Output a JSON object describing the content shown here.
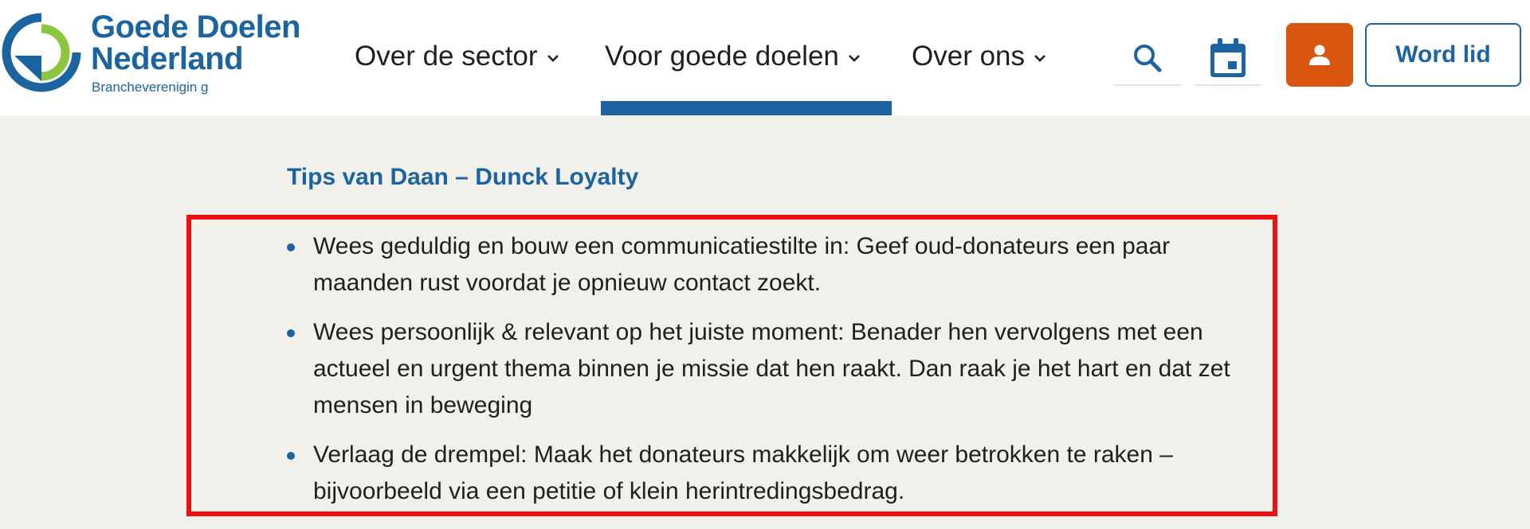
{
  "logo": {
    "line1": "Goede Doelen",
    "line2": "Nederland",
    "subtitle": "Brancheverenigin g"
  },
  "nav": {
    "items": [
      {
        "label": "Over de sector"
      },
      {
        "label": "Voor goede doelen"
      },
      {
        "label": "Over ons"
      }
    ]
  },
  "header_actions": {
    "search_icon": "search-icon",
    "calendar_icon": "calendar-icon",
    "account_icon": "person-icon",
    "join_label": "Word lid"
  },
  "content": {
    "title": "Tips van Daan – Dunck Loyalty",
    "tips": [
      "Wees geduldig en bouw een communicatiestilte in: Geef oud-donateurs een paar maanden rust voordat je opnieuw contact zoekt.",
      "Wees persoonlijk & relevant op het juiste moment: Benader hen vervolgens met een actueel en urgent thema binnen je missie dat hen raakt. Dan raak je het hart en dat zet mensen in beweging",
      "Verlaag de drempel: Maak het donateurs makkelijk om weer betrokken te raken – bijvoorbeeld via een petitie of klein herintredingsbedrag."
    ]
  },
  "colors": {
    "brand_blue": "#1b64a0",
    "brand_green": "#8cc63f",
    "account_orange": "#d9540c",
    "highlight_red": "#ee1111",
    "page_background": "#f2f0eb"
  }
}
